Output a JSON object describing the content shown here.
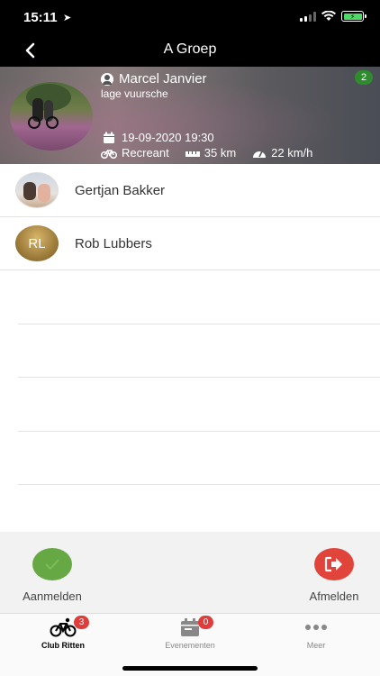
{
  "status_bar": {
    "time": "15:11",
    "location_arrow": "location-arrow-icon",
    "battery_color": "#4cd964"
  },
  "nav": {
    "title": "A Groep",
    "back_icon": "chevron-left-icon"
  },
  "ride": {
    "organizer": "Marcel Janvier",
    "location": "lage vuursche",
    "participant_count": "2",
    "datetime": "19-09-2020 19:30",
    "level": "Recreant",
    "distance": "35 km",
    "speed": "22 km/h"
  },
  "participants": [
    {
      "name": "Gertjan Bakker",
      "avatar": "photo"
    },
    {
      "name": "Rob Lubbers",
      "avatar_initials": "RL"
    }
  ],
  "actions": {
    "join_label": "Aanmelden",
    "join_color": "#66a844",
    "leave_label": "Afmelden",
    "leave_color": "#e0443a"
  },
  "tabs": [
    {
      "label": "Club Ritten",
      "icon": "bicycle-icon",
      "badge": "3",
      "active": true
    },
    {
      "label": "Evenementen",
      "icon": "calendar-icon",
      "badge": "0",
      "active": false
    },
    {
      "label": "Meer",
      "icon": "more-dots-icon",
      "active": false
    }
  ]
}
